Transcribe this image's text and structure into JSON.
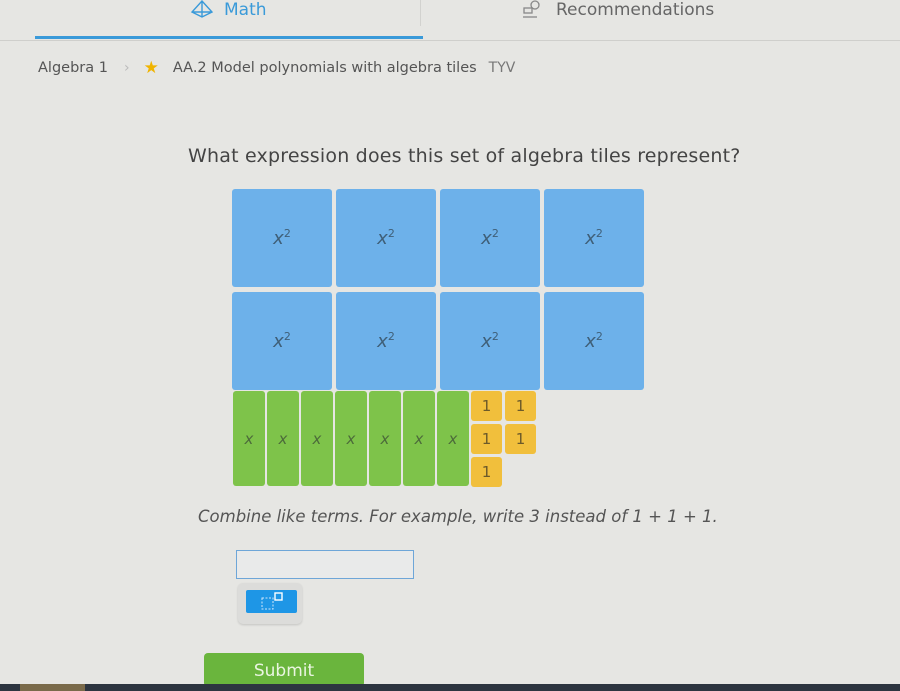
{
  "nav": {
    "tabs": [
      {
        "label": "Math",
        "icon": "pyramid-icon",
        "active": true
      },
      {
        "label": "Recommendations",
        "icon": "recommendations-icon",
        "active": false
      }
    ],
    "accent_color": "#3a9ad9"
  },
  "breadcrumb": {
    "course": "Algebra 1",
    "skill": "AA.2 Model polynomials with algebra tiles",
    "skill_code": "TYV",
    "star_icon": "star-icon"
  },
  "question": {
    "prompt": "What expression does this set of algebra tiles represent?",
    "tiles": {
      "x_squared": {
        "count": 8,
        "label": "x",
        "exponent": "2",
        "color": "#6db1ea"
      },
      "x": {
        "count": 7,
        "label": "x",
        "color": "#7ec34a"
      },
      "unit": {
        "count": 5,
        "label": "1",
        "color": "#f1bf3c"
      }
    },
    "instruction": "Combine like terms. For example, write 3 instead of 1 + 1 + 1."
  },
  "answer": {
    "value": "",
    "placeholder": "",
    "toolbar": {
      "exponent_button_icon": "exponent-icon"
    }
  },
  "submit": {
    "label": "Submit",
    "color": "#6ab53d"
  }
}
